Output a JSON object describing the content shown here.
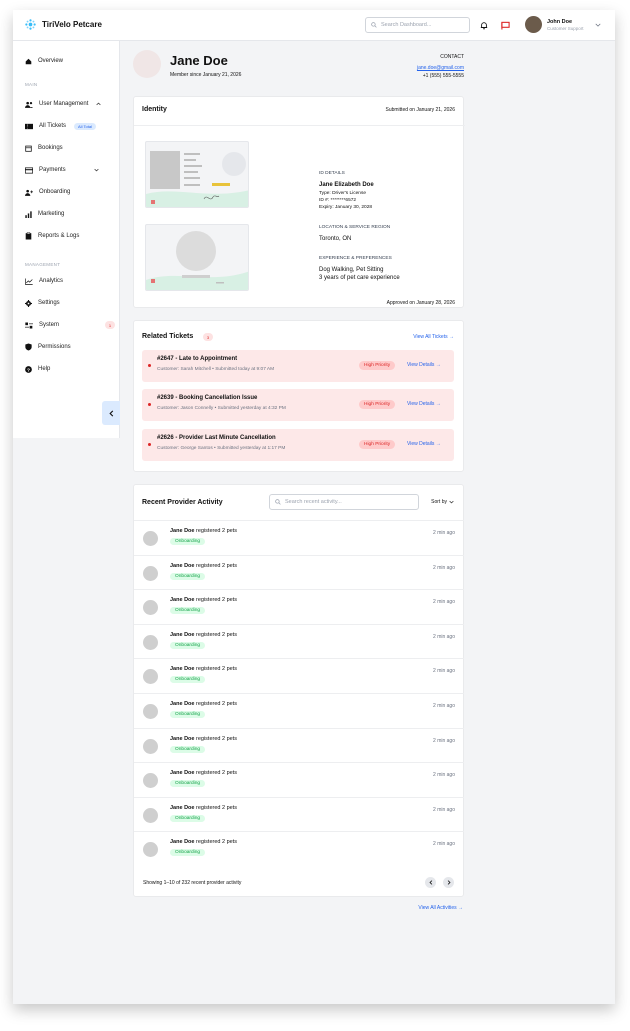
{
  "app": {
    "brand": "TiriVelo Petcare"
  },
  "header": {
    "search_placeholder": "Search Dashboard...",
    "user_name": "John Doe",
    "user_role": "Customer Support"
  },
  "sidebar": {
    "overview": "Overview",
    "section_main": "MAIN",
    "user_management": "User Management",
    "all_tickets": "All Tickets",
    "all_tickets_badge": "All Total",
    "bookings": "Bookings",
    "payments": "Payments",
    "onboarding": "Onboarding",
    "marketing": "Marketing",
    "reports_logs": "Reports & Logs",
    "section_management": "MANAGEMENT",
    "analytics": "Analytics",
    "settings": "Settings",
    "system": "System",
    "system_badge": "1",
    "permissions": "Permissions",
    "help": "Help"
  },
  "profile": {
    "name": "Jane Doe",
    "member_since": "Member since January 21, 2026",
    "contact_label": "CONTACT",
    "email": "jane.doe@gmail.com",
    "phone": "+1 (555) 555-5555"
  },
  "identity": {
    "title": "Identity",
    "submitted": "Submitted on January 21, 2026",
    "id_details_label": "ID DETAILS",
    "full_name": "Jane Elizabeth Doe",
    "type": "Type: Driver's License",
    "id_number": "ID #: ********6572",
    "expiry": "Expiry: January 30, 2028",
    "region_label": "LOCATION & SERVICE REGION",
    "region": "Toronto, ON",
    "experience_label": "EXPERIENCE & PREFERENCES",
    "services": "Dog Walking, Pet Sitting",
    "experience": "3 years of pet care experience",
    "approved": "Approved on January 28, 2026"
  },
  "related_tickets": {
    "title": "Related Tickets",
    "count": "3",
    "view_all": "View All Tickets →",
    "items": [
      {
        "title": "#2647 - Late to Appointment",
        "sub": "Customer: Sarah Mitchell • Submitted today at 9:07 AM",
        "priority": "High Priority",
        "action": "View Details →"
      },
      {
        "title": "#2639 - Booking Cancellation Issue",
        "sub": "Customer: Jason Connelly • Submitted yesterday at 4:32 PM",
        "priority": "High Priority",
        "action": "View Details →"
      },
      {
        "title": "#2626 - Provider Last Minute Cancellation",
        "sub": "Customer: George Santos • Submitted yesterday at 1:17 PM",
        "priority": "High Priority",
        "action": "View Details →"
      }
    ]
  },
  "activity": {
    "title": "Recent Provider Activity",
    "search_placeholder": "Search recent activity...",
    "sort_label": "Sort by",
    "items": [
      {
        "name": "Jane Doe",
        "action": " registered 2 pets",
        "tag": "Onboarding",
        "time": "2 min ago"
      },
      {
        "name": "Jane Doe",
        "action": " registered 2 pets",
        "tag": "Onboarding",
        "time": "2 min ago"
      },
      {
        "name": "Jane Doe",
        "action": " registered 2 pets",
        "tag": "Onboarding",
        "time": "2 min ago"
      },
      {
        "name": "Jane Doe",
        "action": " registered 2 pets",
        "tag": "Onboarding",
        "time": "2 min ago"
      },
      {
        "name": "Jane Doe",
        "action": " registered 2 pets",
        "tag": "Onboarding",
        "time": "2 min ago"
      },
      {
        "name": "Jane Doe",
        "action": " registered 2 pets",
        "tag": "Onboarding",
        "time": "2 min ago"
      },
      {
        "name": "Jane Doe",
        "action": " registered 2 pets",
        "tag": "Onboarding",
        "time": "2 min ago"
      },
      {
        "name": "Jane Doe",
        "action": " registered 2 pets",
        "tag": "Onboarding",
        "time": "2 min ago"
      },
      {
        "name": "Jane Doe",
        "action": " registered 2 pets",
        "tag": "Onboarding",
        "time": "2 min ago"
      },
      {
        "name": "Jane Doe",
        "action": " registered 2 pets",
        "tag": "Onboarding",
        "time": "2 min ago"
      }
    ],
    "showing": "Showing 1–10 of 232 recent provider activity",
    "view_all": "View All Activities →"
  },
  "colors": {
    "accent": "#2563eb",
    "danger": "#dc2626",
    "success": "#16a34a"
  }
}
